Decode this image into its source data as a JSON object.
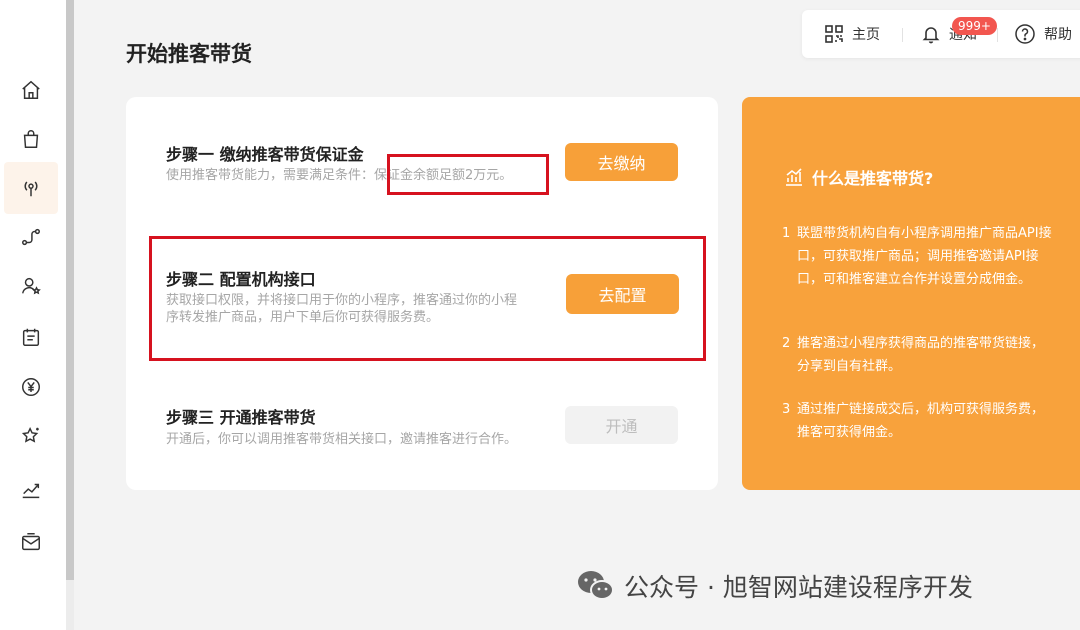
{
  "header": {
    "home_label": "主页",
    "notify_label": "通知",
    "notify_badge": "999+",
    "help_label": "帮助"
  },
  "page": {
    "title": "开始推客带货"
  },
  "steps": [
    {
      "title": "步骤一 缴纳推客带货保证金",
      "desc_prefix": "使用推客带货能力，需要满足条件：",
      "desc_highlight": "保证金余额足额2万元。",
      "button": "去缴纳",
      "button_state": "active"
    },
    {
      "title": "步骤二 配置机构接口",
      "desc_line1": "获取接口权限，并将接口用于你的小程序，推客通过你的小程",
      "desc_line2": "序转发推广商品，用户下单后你可获得服务费。",
      "button": "去配置",
      "button_state": "active"
    },
    {
      "title": "步骤三 开通推客带货",
      "desc": "开通后，你可以调用推客带货相关接口，邀请推客进行合作。",
      "button": "开通",
      "button_state": "disabled"
    }
  ],
  "info": {
    "title": "什么是推客带货?",
    "items": [
      {
        "num": "1",
        "text": "联盟带货机构自有小程序调用推广商品API接口，可获取推广商品；调用推客邀请API接口，可和推客建立合作并设置分成佣金。"
      },
      {
        "num": "2",
        "text": "推客通过小程序获得商品的推客带货链接，分享到自有社群。"
      },
      {
        "num": "3",
        "text": "通过推广链接成交后，机构可获得服务费，推客可获得佣金。"
      }
    ]
  },
  "watermark": {
    "text": "公众号 · 旭智网站建设程序开发"
  },
  "colors": {
    "accent": "#f7a039",
    "highlight_border": "#d6121f",
    "badge": "#f2564f"
  },
  "sidebar": {
    "icons": [
      "home-icon",
      "bag-icon",
      "broadcast-icon",
      "route-icon",
      "user-star-icon",
      "calendar-icon",
      "yuan-icon",
      "sparkle-star-icon",
      "trend-chart-icon",
      "mail-icon"
    ],
    "active": "broadcast-icon"
  }
}
